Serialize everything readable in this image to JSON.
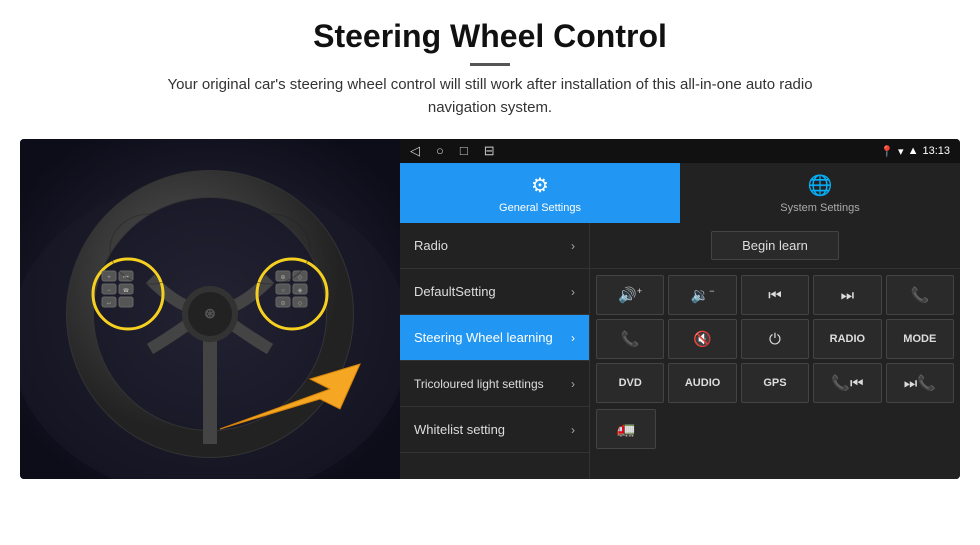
{
  "header": {
    "title": "Steering Wheel Control",
    "subtitle": "Your original car's steering wheel control will still work after installation of this all-in-one auto radio navigation system."
  },
  "statusBar": {
    "time": "13:13",
    "navIcons": [
      "◁",
      "○",
      "□",
      "⊟"
    ]
  },
  "tabs": [
    {
      "id": "general",
      "label": "General Settings",
      "icon": "⚙",
      "active": true
    },
    {
      "id": "system",
      "label": "System Settings",
      "icon": "🌐",
      "active": false
    }
  ],
  "menuItems": [
    {
      "id": "radio",
      "label": "Radio",
      "active": false
    },
    {
      "id": "default",
      "label": "DefaultSetting",
      "active": false
    },
    {
      "id": "steering",
      "label": "Steering Wheel learning",
      "active": true
    },
    {
      "id": "tricolour",
      "label": "Tricoloured light settings",
      "active": false
    },
    {
      "id": "whitelist",
      "label": "Whitelist setting",
      "active": false
    }
  ],
  "rightPanel": {
    "beginLearnLabel": "Begin learn",
    "controlButtons": [
      {
        "id": "vol-up",
        "icon": "🔊+",
        "unicode": "🔊",
        "label": "vol+",
        "type": "icon"
      },
      {
        "id": "vol-down",
        "icon": "🔉-",
        "label": "vol-",
        "type": "icon"
      },
      {
        "id": "prev-track",
        "label": "⏮",
        "type": "icon"
      },
      {
        "id": "next-track",
        "label": "⏭",
        "type": "icon"
      },
      {
        "id": "phone",
        "label": "📞",
        "type": "icon"
      },
      {
        "id": "hang-up",
        "label": "📵",
        "type": "icon"
      },
      {
        "id": "mute",
        "label": "🔇×",
        "type": "icon"
      },
      {
        "id": "power",
        "label": "⏻",
        "type": "icon"
      },
      {
        "id": "radio-btn",
        "label": "RADIO",
        "type": "text"
      },
      {
        "id": "mode-btn",
        "label": "MODE",
        "type": "text"
      },
      {
        "id": "dvd-btn",
        "label": "DVD",
        "type": "text"
      },
      {
        "id": "audio-btn",
        "label": "AUDIO",
        "type": "text"
      },
      {
        "id": "gps-btn",
        "label": "GPS",
        "type": "text"
      },
      {
        "id": "phone-prev",
        "label": "📞⏮",
        "type": "icon"
      },
      {
        "id": "phone-next",
        "label": "⏭📞",
        "type": "icon"
      }
    ],
    "bottomRow": [
      {
        "id": "dvd-btn2",
        "label": "DVD",
        "type": "text"
      },
      {
        "id": "audio-btn2",
        "label": "AUDIO",
        "type": "text"
      },
      {
        "id": "gps-btn2",
        "label": "GPS",
        "type": "text"
      },
      {
        "id": "phone-prev2",
        "type": "icon"
      },
      {
        "id": "phone-next2",
        "type": "icon"
      }
    ]
  }
}
